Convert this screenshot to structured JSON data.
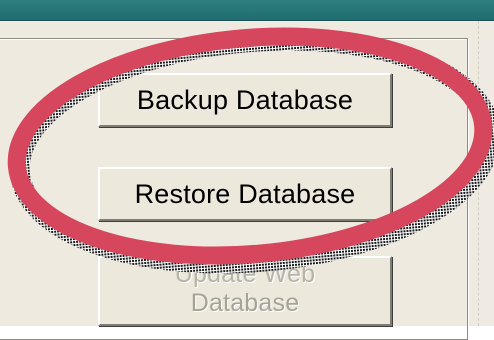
{
  "window": {
    "title": ""
  },
  "buttons": {
    "backup_label": "Backup Database",
    "restore_label": "Restore Database",
    "third_label_line1": "Update Web",
    "third_label_line2": "Database"
  },
  "annotation": {
    "highlight_color": "#d6475d",
    "shadow_color": "#1a1a1a"
  },
  "colors": {
    "titlebar": "#2a7a7b",
    "panel": "#eeeae0"
  }
}
